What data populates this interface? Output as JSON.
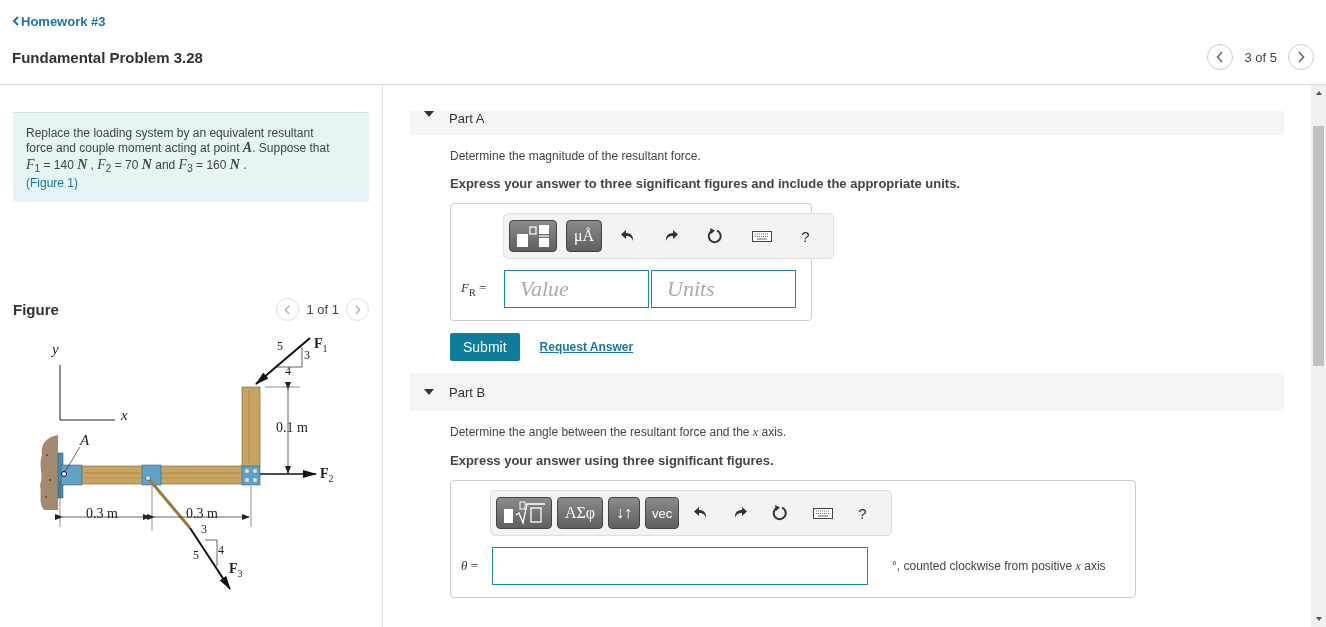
{
  "breadcrumb": {
    "label": "Homework #3"
  },
  "title": "Fundamental Problem 3.28",
  "pager": {
    "text": "3 of 5"
  },
  "problem": {
    "text": "Replace the loading system by an equivalent resultant force and couple moment acting at point **A**. Suppose that *F*$_{1}$ = 140 **N** , *F*$_{2}$ = 70 **N** and *F*$_{3}$ = 160 **N** .",
    "figure_link": "(Figure 1)"
  },
  "figure": {
    "heading": "Figure",
    "pager": "1 of 1",
    "labels": [
      {
        "kind": "axis",
        "text": "y"
      },
      {
        "kind": "axis",
        "text": "x"
      },
      {
        "kind": "point",
        "text": "A"
      },
      {
        "kind": "slope",
        "text": "5"
      },
      {
        "kind": "slope",
        "text": "3"
      },
      {
        "kind": "slope",
        "text": "4"
      },
      {
        "kind": "force",
        "text": "**F**$_{1}$"
      },
      {
        "kind": "dimension",
        "text": "0.1 m"
      },
      {
        "kind": "force",
        "text": "**F**$_{2}$"
      },
      {
        "kind": "dimension",
        "text": "0.3 m"
      },
      {
        "kind": "dimension",
        "text": "0.3 m"
      },
      {
        "kind": "slope",
        "text": "3"
      },
      {
        "kind": "slope",
        "text": "4"
      },
      {
        "kind": "slope",
        "text": "5"
      },
      {
        "kind": "force",
        "text": "**F**$_{3}$"
      }
    ]
  },
  "parts": [
    {
      "title": "Part A",
      "expanded": true,
      "prompt": "Determine the magnitude of the resultant force.",
      "instruction": "Express your answer to three significant figures and include the appropriate units.",
      "toolbar": [
        {
          "kind": "fraction"
        },
        {
          "kind": "text",
          "label": "μÅ"
        },
        {
          "kind": "undo"
        },
        {
          "kind": "redo"
        },
        {
          "kind": "reset"
        },
        {
          "kind": "keyboard"
        },
        {
          "kind": "help",
          "label": "?"
        }
      ],
      "answer_label": "*F*$_{R}$ =",
      "fields": [
        {
          "kind": "value",
          "placeholder": "Value"
        },
        {
          "kind": "units",
          "placeholder": "Units"
        }
      ],
      "submit": "Submit",
      "request": "Request Answer"
    },
    {
      "title": "Part B",
      "expanded": true,
      "prompt": "Determine the angle between the resultant force and the *x* axis.",
      "instruction": "Express your answer using three significant figures.",
      "toolbar": [
        {
          "kind": "root"
        },
        {
          "kind": "text",
          "label": "ΑΣφ"
        },
        {
          "kind": "text",
          "label": "↓↑"
        },
        {
          "kind": "small-text",
          "label": "vec"
        },
        {
          "kind": "undo"
        },
        {
          "kind": "redo"
        },
        {
          "kind": "reset"
        },
        {
          "kind": "keyboard"
        },
        {
          "kind": "help",
          "label": "?"
        }
      ],
      "answer_label": "*θ* =",
      "fields": [
        {
          "kind": "wide"
        }
      ],
      "suffix_text": "°, counted clockwise from positive *x* axis"
    }
  ]
}
